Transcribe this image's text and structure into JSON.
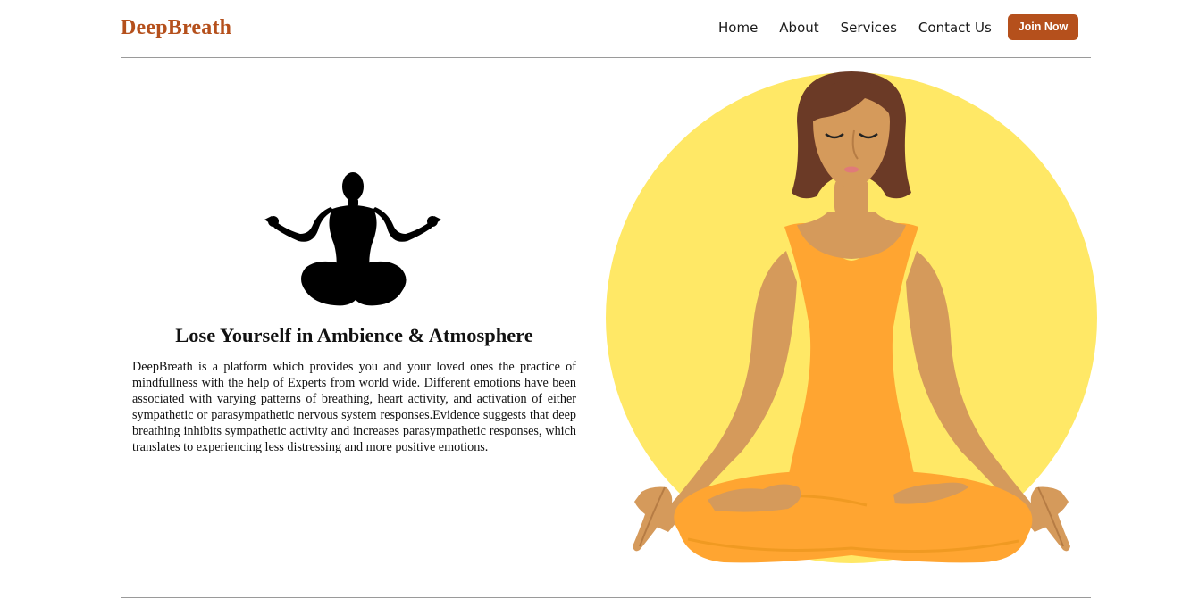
{
  "header": {
    "brand": "DeepBreath",
    "nav": {
      "home": "Home",
      "about": "About",
      "services": "Services",
      "contact": "Contact Us"
    },
    "join_label": "Join Now"
  },
  "main": {
    "heading": "Lose Yourself in Ambience & Atmosphere",
    "description": "DeepBreath is a platform which provides you and your loved ones the practice of mindfullness with the help of Experts from world wide. Different emotions have been associated with varying patterns of breathing, heart activity, and activation of either sympathetic or parasympathetic nervous system responses.Evidence suggests that deep breathing inhibits sympathetic activity and increases parasympathetic responses, which translates to experiencing less distressing and more positive emotions."
  },
  "colors": {
    "brand": "#b5501c",
    "sun": "#ffe866",
    "outfit": "#ffa531",
    "skin": "#d59a5b",
    "hair": "#6b3a26"
  },
  "icons": {
    "silhouette": "meditation-silhouette-icon",
    "hero": "meditating-woman-illustration"
  }
}
